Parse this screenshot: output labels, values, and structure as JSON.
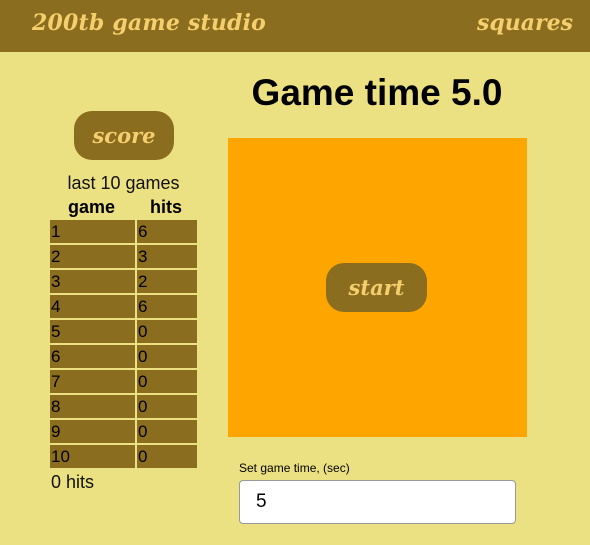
{
  "header": {
    "brand": "200tb game studio",
    "game_name": "squares"
  },
  "game_time_title": "Game time 5.0",
  "score_button": "score",
  "scores": {
    "caption": "last 10 games",
    "col_game": "game",
    "col_hits": "hits",
    "rows": [
      {
        "game": "1",
        "hits": "6"
      },
      {
        "game": "2",
        "hits": "3"
      },
      {
        "game": "3",
        "hits": "2"
      },
      {
        "game": "4",
        "hits": "6"
      },
      {
        "game": "5",
        "hits": "0"
      },
      {
        "game": "6",
        "hits": "0"
      },
      {
        "game": "7",
        "hits": "0"
      },
      {
        "game": "8",
        "hits": "0"
      },
      {
        "game": "9",
        "hits": "0"
      },
      {
        "game": "10",
        "hits": "0"
      }
    ],
    "total": "0 hits"
  },
  "play_area": {
    "start_label": "start",
    "color": "#ffa500"
  },
  "settings": {
    "time_label": "Set game time, (sec)",
    "time_value": "5"
  },
  "colors": {
    "background": "#ece182",
    "brand_brown": "#8b6d1f",
    "accent_text": "#f5cf6e"
  }
}
